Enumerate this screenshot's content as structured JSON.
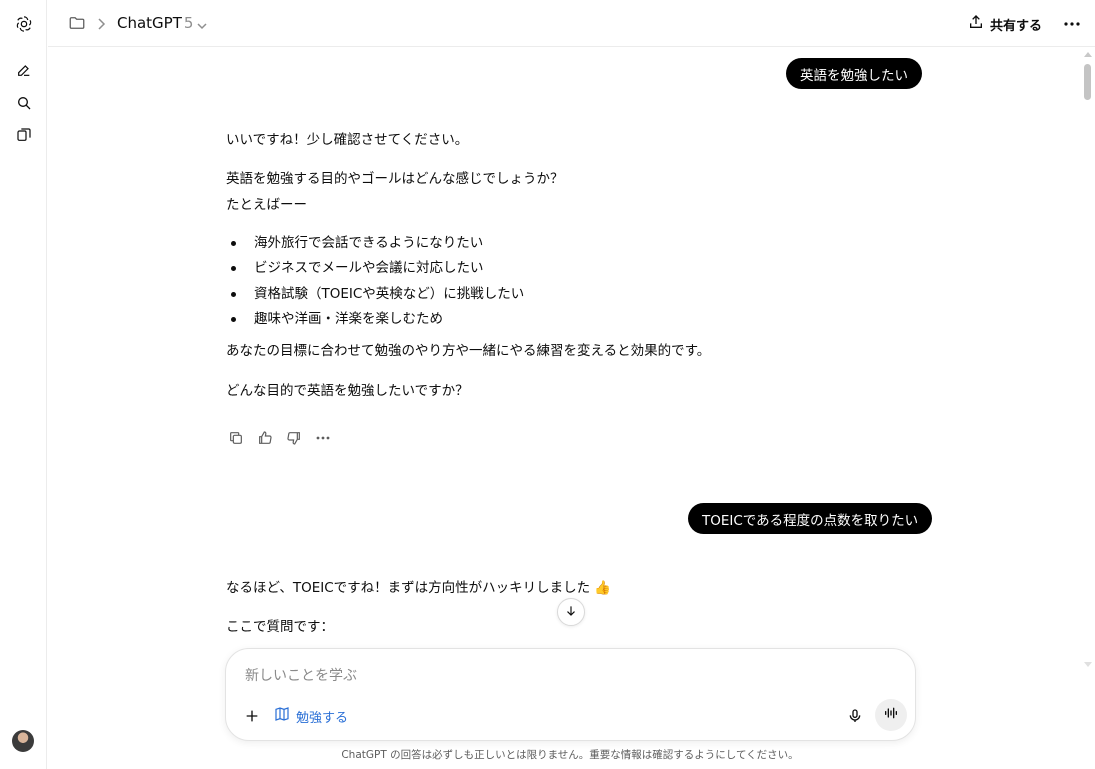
{
  "rail": {
    "logo_icon": "openai-logo-icon",
    "items": [
      {
        "icon": "new-chat-icon"
      },
      {
        "icon": "search-icon"
      },
      {
        "icon": "library-icon"
      }
    ]
  },
  "header": {
    "title": "ChatGPT",
    "version": "5",
    "share_label": "共有する"
  },
  "conversation": {
    "user_message_1": "英語を勉強したい",
    "assistant_1": {
      "intro": "いいですね！少し確認させてください。",
      "question": "英語を勉強する目的やゴールはどんな感じでしょうか？",
      "lead": "たとえばーー",
      "bullets": [
        "海外旅行で会話できるようになりたい",
        "ビジネスでメールや会議に対応したい",
        "資格試験（TOEICや英検など）に挑戦したい",
        "趣味や洋画・洋楽を楽しむため"
      ],
      "note": "あなたの目標に合わせて勉強のやり方や一緒にやる練習を変えると効果的です。",
      "closing": "どんな目的で英語を勉強したいですか？"
    },
    "user_message_2": "TOEICである程度の点数を取りたい",
    "assistant_2": {
      "line1": "なるほど、TOEICですね！まずは方向性がハッキリしました 👍",
      "line2": "ここで質問です："
    }
  },
  "composer": {
    "placeholder": "新しいことを学ぶ",
    "study_label": "勉強する"
  },
  "disclaimer": "ChatGPT の回答は必ずしも正しいとは限りません。重要な情報は確認するようにしてください。",
  "colors": {
    "accent_blue": "#2a6fd6",
    "bubble": "#000000"
  }
}
